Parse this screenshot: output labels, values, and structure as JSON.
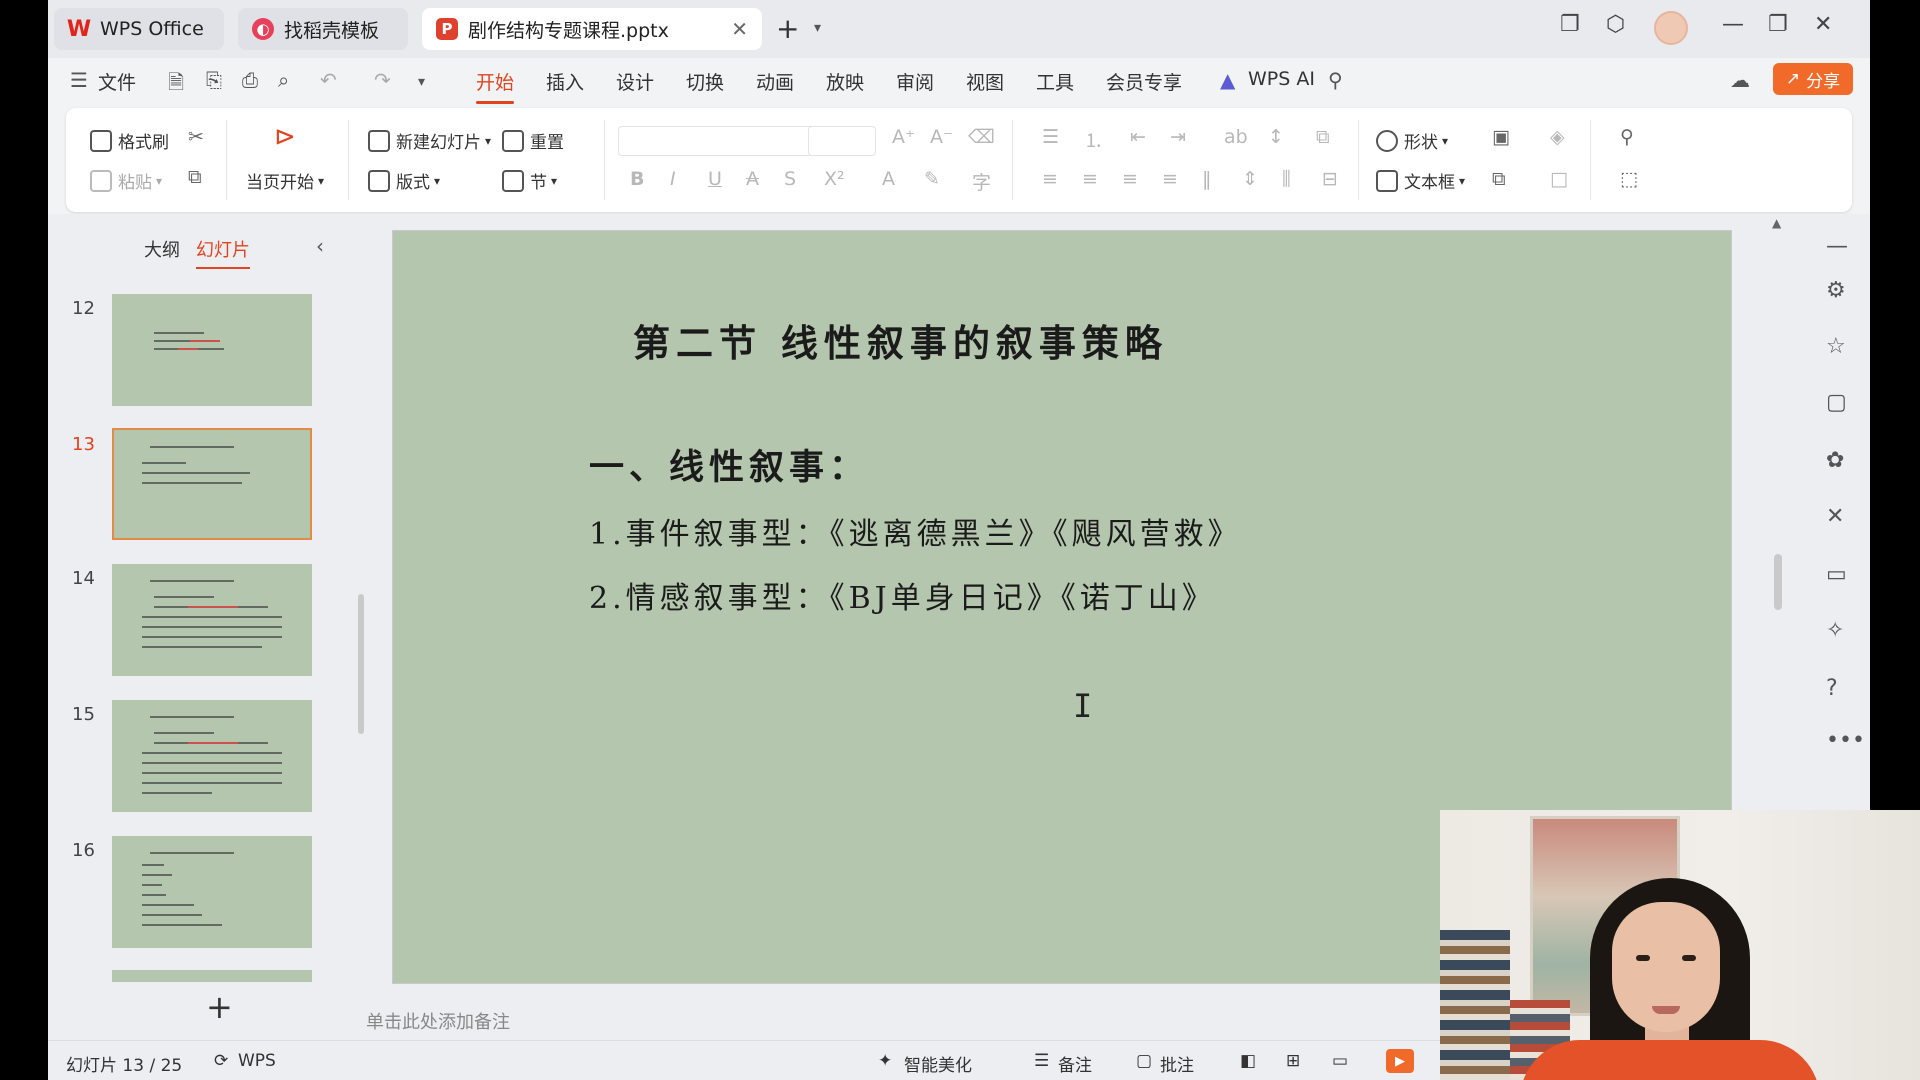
{
  "tabs": [
    {
      "label": "WPS Office",
      "icon": "wps-logo-icon"
    },
    {
      "label": "找稻壳模板",
      "icon": "docer-icon"
    },
    {
      "label": "剧作结构专题课程.pptx",
      "icon": "ppt-file-icon"
    }
  ],
  "menu": {
    "file": "文件",
    "tabs": [
      "开始",
      "插入",
      "设计",
      "切换",
      "动画",
      "放映",
      "审阅",
      "视图",
      "工具",
      "会员专享"
    ],
    "active_tab": "开始",
    "wps_ai": "WPS AI",
    "share": "分享"
  },
  "ribbon": {
    "format_painter": "格式刷",
    "paste": "粘贴",
    "from_current": "当页开始",
    "new_slide": "新建幻灯片",
    "layout": "版式",
    "reset": "重置",
    "section": "节",
    "shape": "形状",
    "textbox": "文本框"
  },
  "panel": {
    "outline_tab": "大纲",
    "slides_tab": "幻灯片",
    "thumbnails": [
      {
        "number": "12"
      },
      {
        "number": "13"
      },
      {
        "number": "14"
      },
      {
        "number": "15"
      },
      {
        "number": "16"
      }
    ],
    "active_slide": "13"
  },
  "slide": {
    "title": "第二节  线性叙事的叙事策略",
    "heading": "一、线性叙事：",
    "lines": [
      "1.事件叙事型：《逃离德黑兰》《飓风营救》",
      "2.情感叙事型：《BJ单身日记》《诺丁山》"
    ]
  },
  "notes_placeholder": "单击此处添加备注",
  "status": {
    "slide_counter": "幻灯片 13 / 25",
    "brand": "WPS",
    "smart_beautify": "智能美化",
    "notes": "备注",
    "comment": "批注"
  },
  "colors": {
    "accent": "#e2441f",
    "slide_bg": "#b4c6ad",
    "share_button": "#f26a2a"
  }
}
